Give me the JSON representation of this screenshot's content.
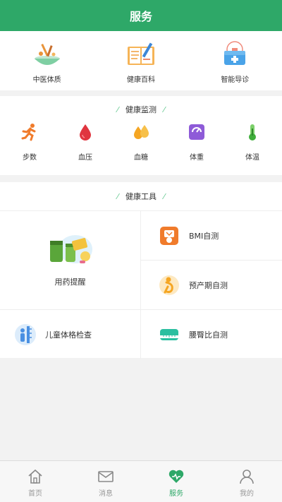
{
  "header": {
    "title": "服务"
  },
  "services": [
    {
      "label": "中医体质",
      "icon": "herbal-bowl-icon"
    },
    {
      "label": "健康百科",
      "icon": "health-book-icon"
    },
    {
      "label": "智能导诊",
      "icon": "medical-kit-icon"
    }
  ],
  "monitor": {
    "title": "健康监测",
    "items": [
      {
        "label": "步数",
        "icon": "running-icon"
      },
      {
        "label": "血压",
        "icon": "blood-drop-icon"
      },
      {
        "label": "血糖",
        "icon": "glucose-drops-icon"
      },
      {
        "label": "体重",
        "icon": "scale-icon"
      },
      {
        "label": "体温",
        "icon": "thermometer-icon"
      }
    ]
  },
  "tools": {
    "title": "健康工具",
    "medicine": "用药提醒",
    "bmi": "BMI自测",
    "due_date": "预产期自测",
    "child_check": "儿童体格检查",
    "waist_hip": "腰臀比自测"
  },
  "tabbar": [
    {
      "label": "首页",
      "icon": "home-icon"
    },
    {
      "label": "消息",
      "icon": "mail-icon"
    },
    {
      "label": "服务",
      "icon": "heart-icon"
    },
    {
      "label": "我的",
      "icon": "user-icon"
    }
  ],
  "colors": {
    "brand": "#2ea868",
    "inactive": "#999999"
  }
}
